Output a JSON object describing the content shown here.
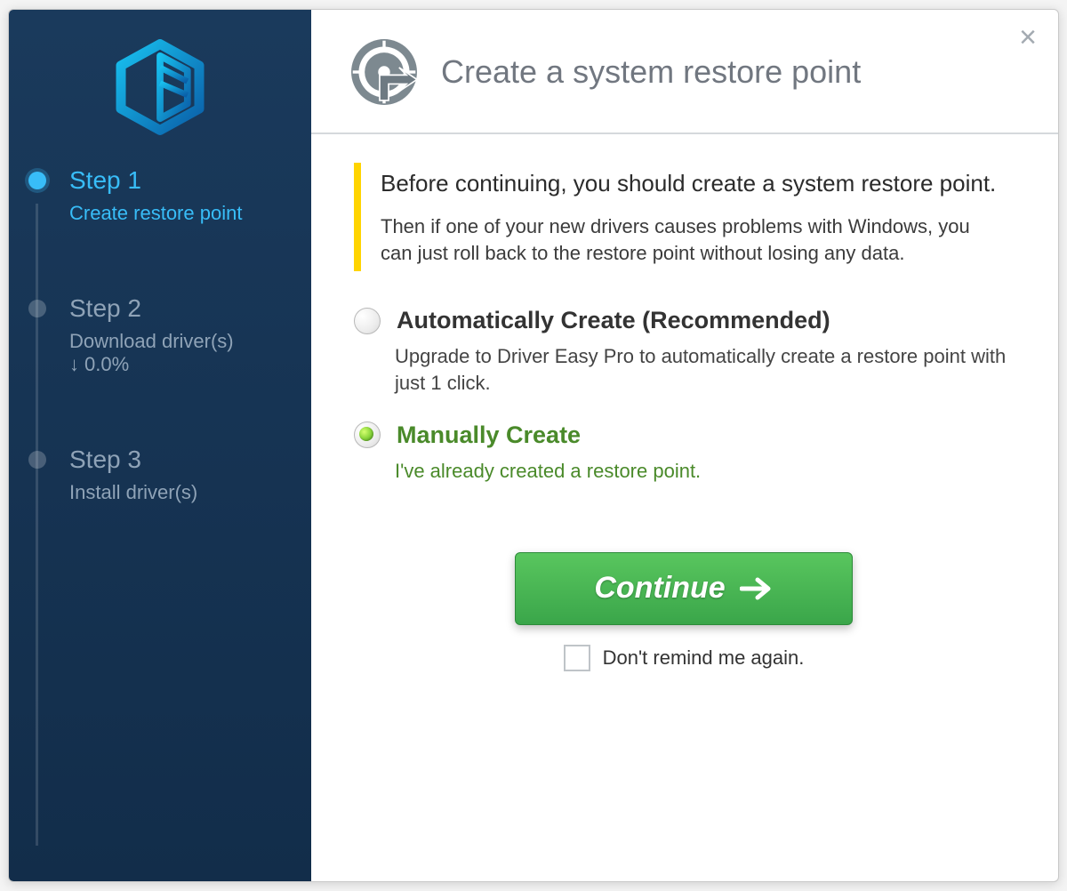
{
  "sidebar": {
    "steps": [
      {
        "title": "Step 1",
        "subtitle": "Create restore point"
      },
      {
        "title": "Step 2",
        "subtitle": "Download driver(s)",
        "progress": "0.0%"
      },
      {
        "title": "Step 3",
        "subtitle": "Install driver(s)"
      }
    ],
    "active_index": 0
  },
  "header": {
    "title": "Create a system restore point"
  },
  "callout": {
    "lead": "Before continuing, you should create a system restore point.",
    "sub": "Then if one of your new drivers causes problems with Windows, you can just roll back to the restore point without losing any data."
  },
  "options": {
    "auto": {
      "label": "Automatically Create (Recommended)",
      "description": "Upgrade to Driver Easy Pro to automatically create a restore point with just 1 click.",
      "selected": false
    },
    "manual": {
      "label": "Manually Create",
      "description": "I've already created a restore point.",
      "selected": true
    }
  },
  "actions": {
    "continue_label": "Continue",
    "dont_remind_label": "Don't remind me again.",
    "dont_remind_checked": false
  },
  "colors": {
    "accent_blue": "#38bdf8",
    "green": "#4a8a2a",
    "yellow": "#ffd400"
  }
}
